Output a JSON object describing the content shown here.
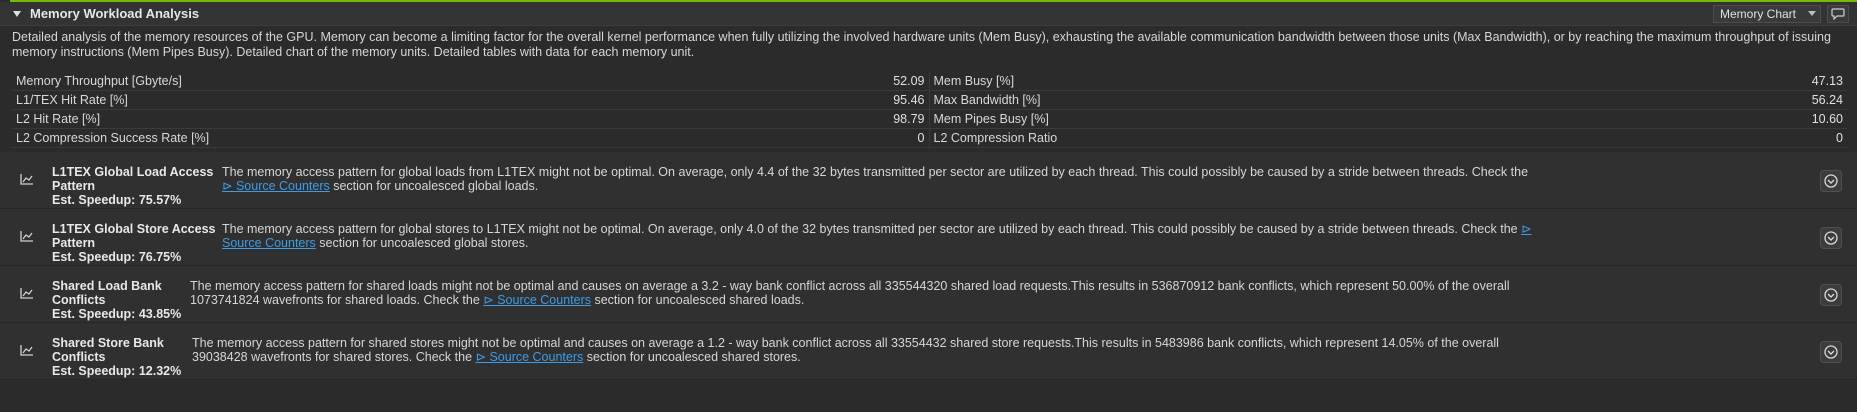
{
  "section": {
    "title": "Memory Workload Analysis",
    "view_select": "Memory Chart",
    "description": "Detailed analysis of the memory resources of the GPU. Memory can become a limiting factor for the overall kernel performance when fully utilizing the involved hardware units (Mem Busy), exhausting the available communication bandwidth between those units (Max Bandwidth), or by reaching the maximum throughput of issuing memory instructions (Mem Pipes Busy). Detailed chart of the memory units. Detailed tables with data for each memory unit."
  },
  "metrics": [
    {
      "left_label": "Memory Throughput [Gbyte/s]",
      "left_value": "52.09",
      "right_label": "Mem Busy [%]",
      "right_value": "47.13"
    },
    {
      "left_label": "L1/TEX Hit Rate [%]",
      "left_value": "95.46",
      "right_label": "Max Bandwidth [%]",
      "right_value": "56.24"
    },
    {
      "left_label": "L2 Hit Rate [%]",
      "left_value": "98.79",
      "right_label": "Mem Pipes Busy [%]",
      "right_value": "10.60"
    },
    {
      "left_label": "L2 Compression Success Rate [%]",
      "left_value": "0",
      "right_label": "L2 Compression Ratio",
      "right_value": "0"
    }
  ],
  "rules": [
    {
      "title": "L1TEX Global Load Access Pattern",
      "speedup": "Est. Speedup: 75.57%",
      "text_before": "The memory access pattern for global loads from L1TEX might not be optimal. On average, only 4.4 of the 32 bytes transmitted per sector are utilized by each thread. This could possibly be caused by a stride between threads. Check the ",
      "link": "⊳ Source Counters",
      "text_after": " section for uncoalesced global loads."
    },
    {
      "title": "L1TEX Global Store Access Pattern",
      "speedup": "Est. Speedup: 76.75%",
      "text_before": "The memory access pattern for global stores to L1TEX might not be optimal. On average, only 4.0 of the 32 bytes transmitted per sector are utilized by each thread. This could possibly be caused by a stride between threads. Check the ",
      "link": "⊳ Source Counters",
      "text_after": " section for uncoalesced global stores."
    },
    {
      "title": "Shared Load Bank Conflicts",
      "speedup": "Est. Speedup: 43.85%",
      "text_before": "The memory access pattern for shared loads might not be optimal and causes on average a 3.2 - way bank conflict across all 335544320 shared load requests.This results in 536870912 bank conflicts, which represent 50.00% of the overall 1073741824 wavefronts for shared loads. Check the ",
      "link": "⊳ Source Counters",
      "text_after": " section for uncoalesced shared loads."
    },
    {
      "title": "Shared Store Bank Conflicts",
      "speedup": "Est. Speedup: 12.32%",
      "text_before": "The memory access pattern for shared stores might not be optimal and causes on average a 1.2 - way bank conflict across all 33554432 shared store requests.This results in 5483986 bank conflicts, which represent 14.05% of the overall 39038428 wavefronts for shared stores. Check the ",
      "link": "⊳ Source Counters",
      "text_after": " section for uncoalesced shared stores."
    }
  ],
  "colors": {
    "accent": "#76b900",
    "link": "#3a9de6",
    "background": "#2b2b2b"
  },
  "icons": {
    "collapse": "triangle-down-icon",
    "comment": "speech-bubble-icon",
    "rule": "line-chart-icon",
    "expand": "chevron-down-circle-icon"
  }
}
